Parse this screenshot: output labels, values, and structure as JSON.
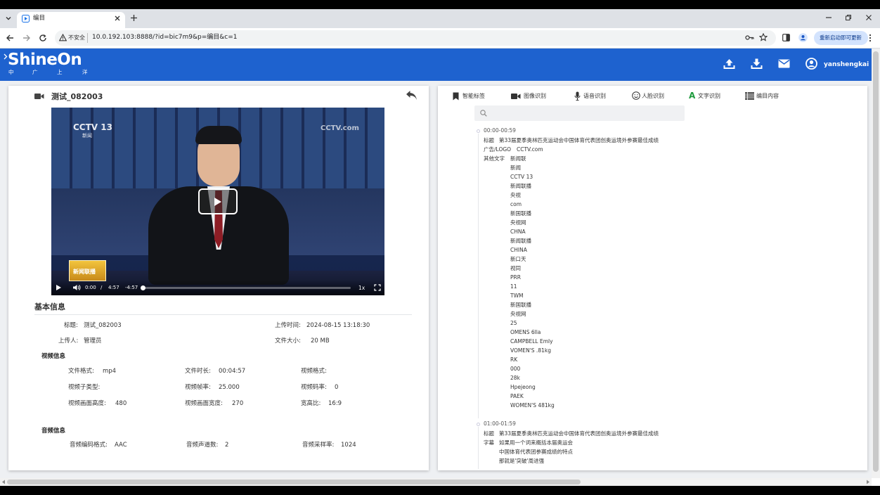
{
  "browser": {
    "tab_title": "编目",
    "security_label": "不安全",
    "url": "10.0.192.103:8888/?id=bic7m9&p=编目&c=1",
    "update_button": "重新启动即可更新"
  },
  "header": {
    "logo_text": "ShineOn",
    "logo_sub": [
      "中",
      "广",
      "上",
      "洋"
    ],
    "username": "yanshengkai"
  },
  "video_panel": {
    "title": "测试_082003",
    "player": {
      "current_time": "0:00",
      "separator": "/",
      "duration": "4:57",
      "remaining": "-4:57",
      "speed": "1x",
      "progress": 0,
      "channel_logo": "CCTV 13",
      "channel_sub": "新闻",
      "watermark": "CCTV.com",
      "program_logo": "新闻联播"
    }
  },
  "basic_info": {
    "heading": "基本信息",
    "title_label": "标题:",
    "title_value": "测试_082003",
    "upload_time_label": "上传时间:",
    "upload_time_value": "2024-08-15 13:18:30",
    "uploader_label": "上传人:",
    "uploader_value": "管理员",
    "file_size_label": "文件大小:",
    "file_size_value": "20 MB"
  },
  "video_info": {
    "heading": "视频信息",
    "rows": [
      [
        {
          "label": "文件格式:",
          "value": "mp4"
        },
        {
          "label": "文件时长:",
          "value": "00:04:57"
        },
        {
          "label": "视频格式:",
          "value": ""
        }
      ],
      [
        {
          "label": "视频子类型:",
          "value": ""
        },
        {
          "label": "视频帧率:",
          "value": "25.000"
        },
        {
          "label": "视频码率:",
          "value": "0"
        }
      ],
      [
        {
          "label": "视频画面高度:",
          "value": "480"
        },
        {
          "label": "视频画面宽度:",
          "value": "270"
        },
        {
          "label": "宽高比:",
          "value": "16:9"
        }
      ]
    ]
  },
  "audio_info": {
    "heading": "音频信息",
    "rows": [
      [
        {
          "label": "音频编码格式:",
          "value": "AAC"
        },
        {
          "label": "音频声道数:",
          "value": "2"
        },
        {
          "label": "音频采样率:",
          "value": "1024"
        }
      ]
    ]
  },
  "tabs": [
    {
      "label": "智能标签",
      "icon": "bookmark-icon"
    },
    {
      "label": "图像识别",
      "icon": "video-camera-icon"
    },
    {
      "label": "语音识别",
      "icon": "microphone-icon"
    },
    {
      "label": "人脸识别",
      "icon": "face-icon"
    },
    {
      "label": "文字识别",
      "icon": "letter-a-icon"
    },
    {
      "label": "编目内容",
      "icon": "list-icon"
    }
  ],
  "search": {
    "placeholder": ""
  },
  "segments": [
    {
      "time": "00:00-00:59",
      "title_label": "标题",
      "title": "第33届夏季奥林匹克运动会中国体育代表团创奥运境外参赛最佳成绩",
      "logo_label": "广告/LOGO",
      "logo": "CCTV.com",
      "other_label": "其他文字",
      "other_texts": [
        "新闻联",
        "新闻",
        "CCTV 13",
        "新闻联播",
        "央视",
        "com",
        "新国联播",
        "央视网",
        "CHNA",
        "新闻联播",
        "CHINA",
        "新口天",
        "视同",
        "PRR",
        "11",
        "TWM",
        "新国联播",
        "央视网",
        "25",
        "OMENS 6lla",
        "CAMPBELL Emly",
        "VOMEN'S .81kg",
        "RK",
        "000",
        "28k",
        "Hpejeong",
        "PAEK",
        "WOMEN'S 481kg"
      ]
    },
    {
      "time": "01:00-01:59",
      "title_label": "标题",
      "title": "第33届夏季奥林匹克运动会中国体育代表团创奥运境外参赛最佳成绩",
      "subtitle_label": "字幕",
      "subtitles": [
        "如果用一个词来概括本届奥运会",
        "中国体育代表团参赛成绩的特点",
        "那就是'突破'周进强"
      ]
    }
  ],
  "colors": {
    "header_blue": "#1e62cf",
    "accent_green": "#1d9a3c"
  }
}
